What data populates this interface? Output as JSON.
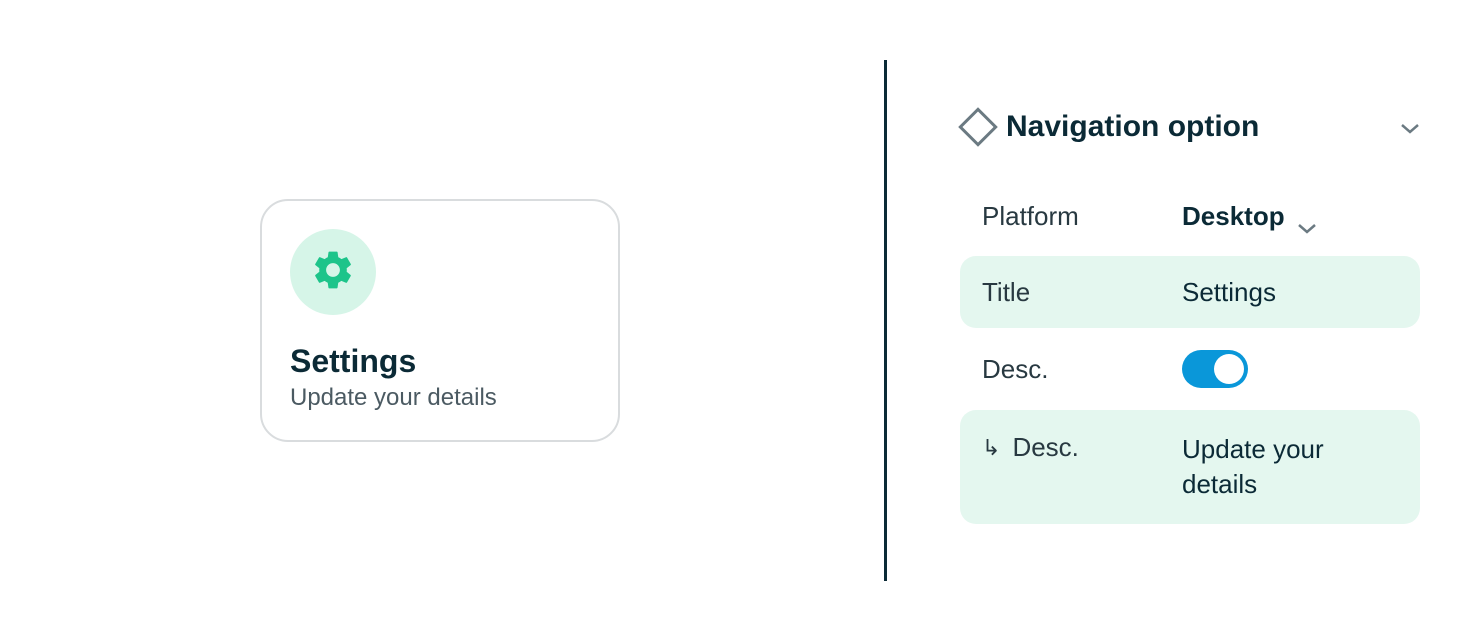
{
  "preview": {
    "icon": "gear",
    "title": "Settings",
    "description": "Update your details"
  },
  "panel": {
    "header": "Navigation option",
    "rows": {
      "platform": {
        "label": "Platform",
        "value": "Desktop"
      },
      "title": {
        "label": "Title",
        "value": "Settings"
      },
      "descToggle": {
        "label": "Desc.",
        "on": true
      },
      "descValue": {
        "label": "Desc.",
        "value": "Update your details"
      }
    }
  }
}
